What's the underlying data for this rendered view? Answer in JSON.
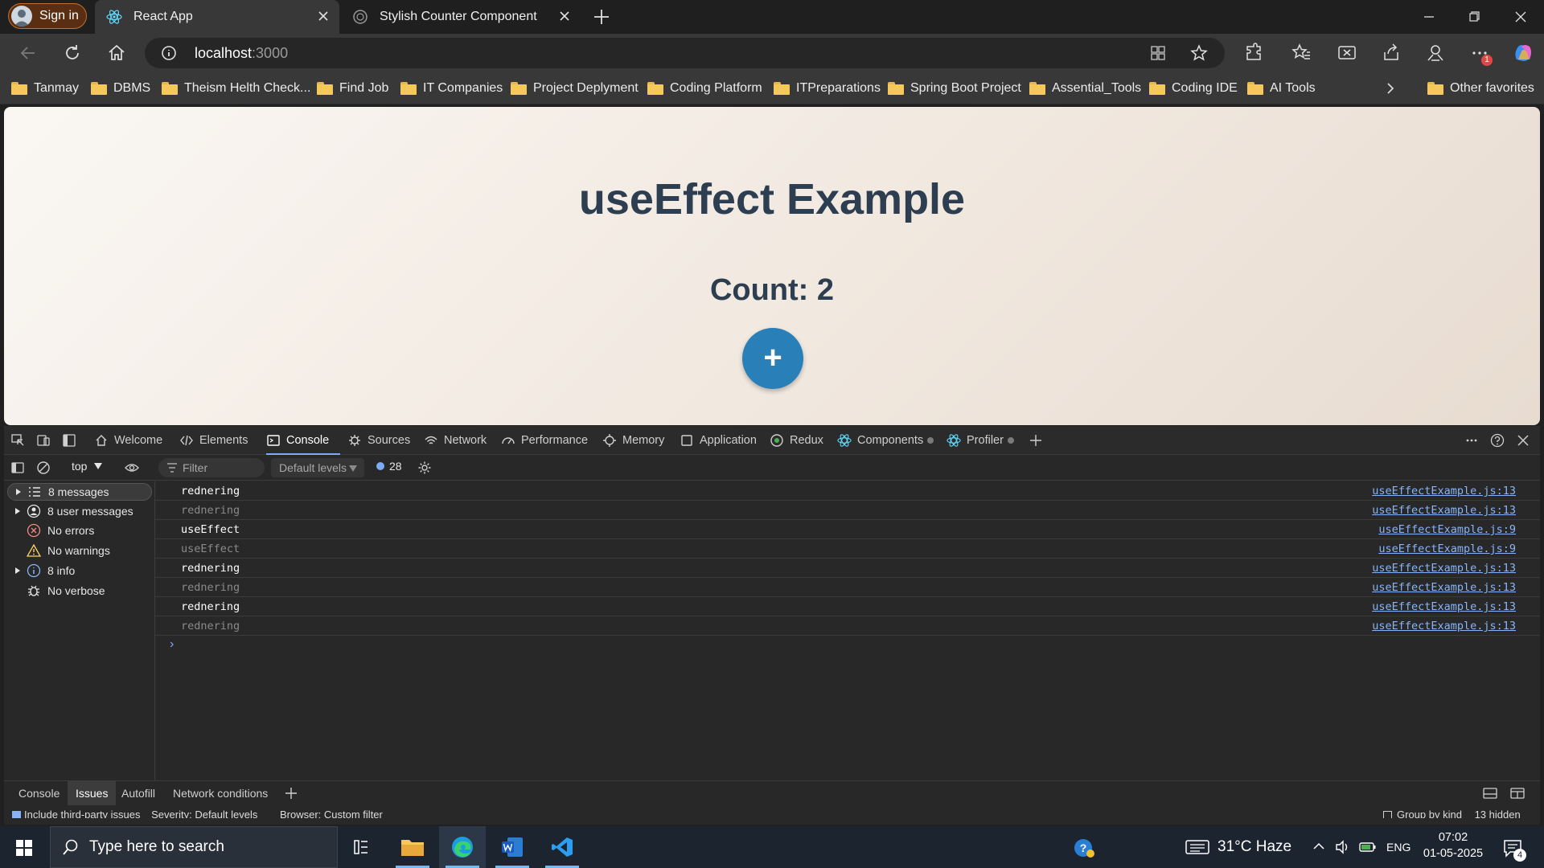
{
  "browser": {
    "signin_label": "Sign in",
    "tabs": [
      {
        "title": "React App",
        "active": true
      },
      {
        "title": "Stylish Counter Component",
        "active": false
      }
    ],
    "address": {
      "host": "localhost",
      "port": ":3000"
    },
    "bookmarks": [
      "Tanmay",
      "DBMS",
      "Theism Helth Check...",
      "Find Job",
      "IT Companies",
      "Project Deplyment",
      "Coding Platform",
      "ITPreparations",
      "Spring Boot Project",
      "Assential_Tools",
      "Coding IDE",
      "AI Tools"
    ],
    "other_favorites": "Other favorites",
    "notification_badge": "1"
  },
  "page": {
    "heading": "useEffect Example",
    "count_text": "Count: 2",
    "plus_label": "+"
  },
  "devtools": {
    "tabs": [
      "Welcome",
      "Elements",
      "Console",
      "Sources",
      "Network",
      "Performance",
      "Memory",
      "Application",
      "Redux",
      "Components",
      "Profiler"
    ],
    "active_tab": "Console",
    "context": "top",
    "filter_placeholder": "Filter",
    "levels": "Default levels",
    "issues_count": "28",
    "sidebar": [
      {
        "label": "8 messages",
        "expandable": true,
        "selected": true,
        "icon": "list-icon"
      },
      {
        "label": "8 user messages",
        "expandable": true,
        "selected": false,
        "icon": "user-icon"
      },
      {
        "label": "No errors",
        "expandable": false,
        "selected": false,
        "icon": "error-icon"
      },
      {
        "label": "No warnings",
        "expandable": false,
        "selected": false,
        "icon": "warning-icon"
      },
      {
        "label": "8 info",
        "expandable": true,
        "selected": false,
        "icon": "info-icon"
      },
      {
        "label": "No verbose",
        "expandable": false,
        "selected": false,
        "icon": "bug-icon"
      }
    ],
    "messages": [
      {
        "text": "rednering",
        "source": "useEffectExample.js:13",
        "style": "bright"
      },
      {
        "text": "rednering",
        "source": "useEffectExample.js:13",
        "style": "dim"
      },
      {
        "text": "useEffect",
        "source": "useEffectExample.js:9",
        "style": "bright"
      },
      {
        "text": "useEffect",
        "source": "useEffectExample.js:9",
        "style": "dim"
      },
      {
        "text": "rednering",
        "source": "useEffectExample.js:13",
        "style": "bright"
      },
      {
        "text": "rednering",
        "source": "useEffectExample.js:13",
        "style": "dim"
      },
      {
        "text": "rednering",
        "source": "useEffectExample.js:13",
        "style": "bright"
      },
      {
        "text": "rednering",
        "source": "useEffectExample.js:13",
        "style": "dim"
      }
    ],
    "prompt": "›",
    "drawer": {
      "tabs": [
        "Console",
        "Issues",
        "Autofill",
        "Network conditions"
      ],
      "active": "Issues",
      "third_party": "Include third-party issues",
      "severity": "Severity: Default levels",
      "browser_filter": "Browser: Custom filter",
      "group_by_kind": "Group by kind",
      "hidden": "13 hidden"
    }
  },
  "taskbar": {
    "search_placeholder": "Type here to search",
    "weather": "31°C  Haze",
    "lang": "ENG",
    "time": "07:02",
    "date": "01-05-2025",
    "notif_count": "4"
  }
}
